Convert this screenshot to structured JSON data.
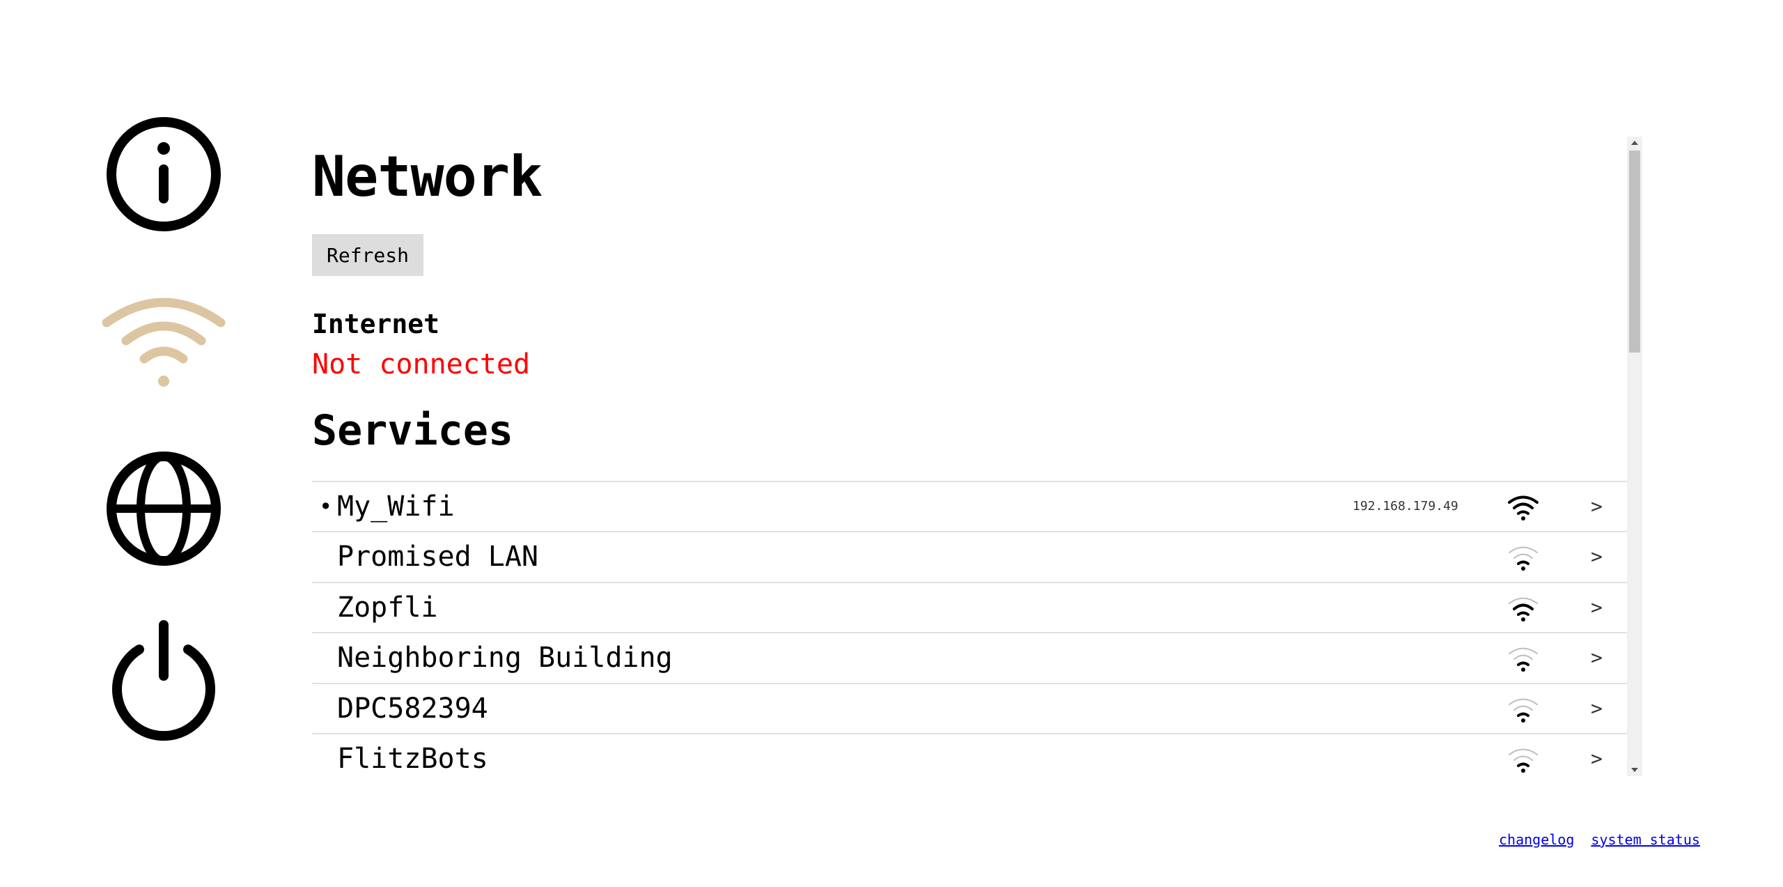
{
  "nav": {
    "items": [
      {
        "icon": "info-icon",
        "color": "#000000"
      },
      {
        "icon": "wifi-icon",
        "color": "#dcc6a1",
        "active": true
      },
      {
        "icon": "globe-icon",
        "color": "#000000"
      },
      {
        "icon": "power-icon",
        "color": "#000000"
      }
    ]
  },
  "main": {
    "title": "Network",
    "refresh_label": "Refresh",
    "internet_label": "Internet",
    "internet_status": "Not connected",
    "internet_status_color": "#ff0000",
    "services_title": "Services"
  },
  "services": [
    {
      "bullet": "•",
      "name": "My_Wifi",
      "ip": "192.168.179.49",
      "signal": "strong",
      "chevron": ">"
    },
    {
      "bullet": "",
      "name": "Promised LAN",
      "ip": "",
      "signal": "weak",
      "chevron": ">"
    },
    {
      "bullet": "",
      "name": "Zopfli",
      "ip": "",
      "signal": "medium",
      "chevron": ">"
    },
    {
      "bullet": "",
      "name": "Neighboring Building",
      "ip": "",
      "signal": "weak",
      "chevron": ">"
    },
    {
      "bullet": "",
      "name": "DPC582394",
      "ip": "",
      "signal": "weak",
      "chevron": ">"
    },
    {
      "bullet": "",
      "name": "FlitzBots",
      "ip": "",
      "signal": "weak",
      "chevron": ">"
    }
  ],
  "footer": {
    "changelog": "changelog",
    "system_status": "system status"
  }
}
